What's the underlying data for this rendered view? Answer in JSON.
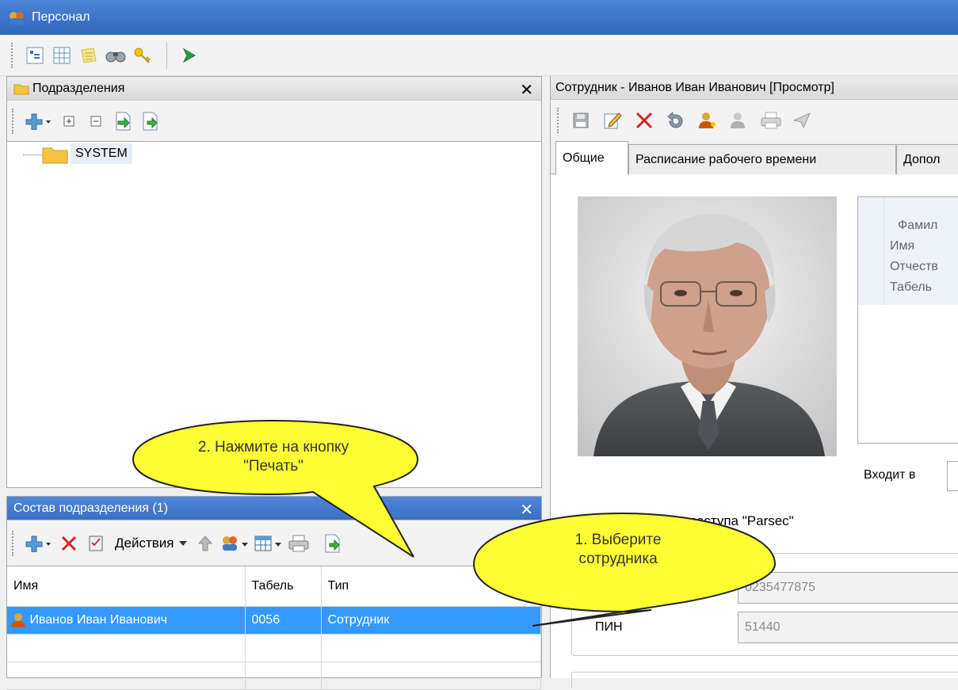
{
  "window": {
    "title": "Персонал"
  },
  "left_panel": {
    "title": "Подразделения",
    "tree": [
      {
        "label": "SYSTEM"
      }
    ]
  },
  "bottom_panel": {
    "title": "Состав подразделения (1)",
    "actions_label": "Действия",
    "columns": [
      "Имя",
      "Табель",
      "Тип"
    ],
    "rows": [
      {
        "name": "Иванов Иван Иванович",
        "tab": "0056",
        "type": "Сотрудник"
      }
    ]
  },
  "right_panel": {
    "title": "Сотрудник - Иванов Иван Иванович [Просмотр]",
    "tabs": [
      "Общие",
      "Расписание рабочего времени",
      "Допол"
    ],
    "fields": [
      "Фамил",
      "Имя",
      "Отчеств",
      "Табель"
    ],
    "belongs_label": "Входит в",
    "access_label": "доступа \"Parsec\"",
    "card_value": "0235477875",
    "pin_label": "ПИН",
    "pin_value": "51440"
  },
  "callouts": {
    "print_hint": "2. Нажмите на кнопку \"Печать\"",
    "select_hint": "1. Выберите сотрудника"
  },
  "colors": {
    "selection": "#3399ff",
    "callout": "#ffff33",
    "titlebar": "#3a72c8"
  }
}
